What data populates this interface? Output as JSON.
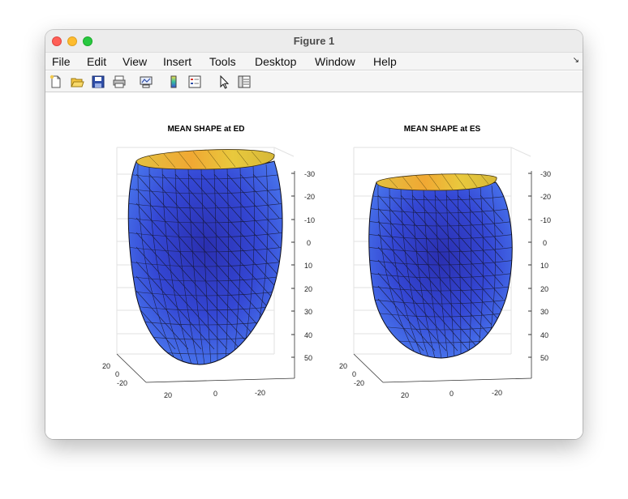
{
  "window": {
    "title": "Figure 1"
  },
  "menu": [
    "File",
    "Edit",
    "View",
    "Insert",
    "Tools",
    "Desktop",
    "Window",
    "Help"
  ],
  "toolbar": {
    "icons": [
      "new-figure-icon",
      "open-file-icon",
      "save-icon",
      "print-icon",
      "link-plot-icon",
      "insert-colorbar-icon",
      "insert-legend-icon",
      "edit-plot-icon",
      "property-inspector-icon"
    ]
  },
  "plots": [
    {
      "title": "MEAN SHAPE at ED",
      "z_ticks": [
        "-30",
        "-20",
        "-10",
        "0",
        "10",
        "20",
        "30",
        "40",
        "50"
      ],
      "x_ticks": [
        "20",
        "0",
        "-20"
      ],
      "y_ticks": [
        "20",
        "0",
        "-20"
      ]
    },
    {
      "title": "MEAN SHAPE at ES",
      "z_ticks": [
        "-30",
        "-20",
        "-10",
        "0",
        "10",
        "20",
        "30",
        "40",
        "50"
      ],
      "x_ticks": [
        "20",
        "0",
        "-20"
      ],
      "y_ticks": [
        "20",
        "0",
        "-20"
      ]
    }
  ],
  "colors": {
    "surface_blue": "#3a4fd9",
    "rim_yellow": "#e8b33a",
    "edge": "#101020"
  }
}
